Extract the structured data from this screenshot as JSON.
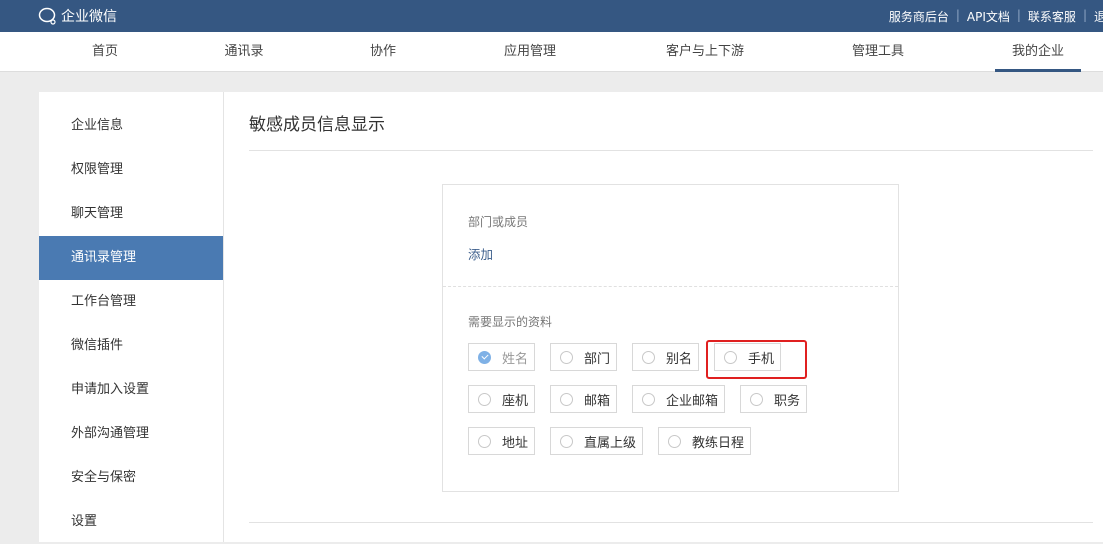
{
  "topbar": {
    "logo": "企业微信",
    "links": [
      "服务商后台",
      "API文档",
      "联系客服",
      "退"
    ]
  },
  "nav": {
    "items": [
      "首页",
      "通讯录",
      "协作",
      "应用管理",
      "客户与上下游",
      "管理工具",
      "我的企业"
    ],
    "active": 6
  },
  "sidebar": {
    "items": [
      "企业信息",
      "权限管理",
      "聊天管理",
      "通讯录管理",
      "工作台管理",
      "微信插件",
      "申请加入设置",
      "外部沟通管理",
      "安全与保密",
      "设置"
    ],
    "active": 3
  },
  "main": {
    "title": "敏感成员信息显示",
    "members_label": "部门或成员",
    "add_link": "添加",
    "fields_label": "需要显示的资料",
    "options": [
      {
        "label": "姓名",
        "checked": true
      },
      {
        "label": "部门",
        "checked": false
      },
      {
        "label": "别名",
        "checked": false
      },
      {
        "label": "手机",
        "checked": false,
        "highlighted": true
      },
      {
        "label": "座机",
        "checked": false
      },
      {
        "label": "邮箱",
        "checked": false
      },
      {
        "label": "企业邮箱",
        "checked": false
      },
      {
        "label": "职务",
        "checked": false
      },
      {
        "label": "地址",
        "checked": false
      },
      {
        "label": "直属上级",
        "checked": false
      },
      {
        "label": "教练日程",
        "checked": false
      }
    ]
  },
  "colors": {
    "topbar": "#355782",
    "active": "#4a7ab2",
    "highlight": "#e02020"
  }
}
